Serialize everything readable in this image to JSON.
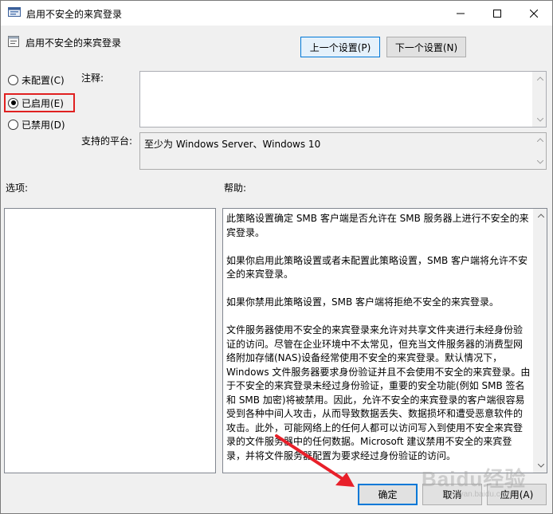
{
  "window": {
    "title": "启用不安全的来宾登录",
    "minimize_icon": "minimize-icon",
    "maximize_icon": "maximize-icon",
    "close_icon": "close-icon"
  },
  "header": {
    "policy_name": "启用不安全的来宾登录",
    "prev_label": "上一个设置(P)",
    "next_label": "下一个设置(N)"
  },
  "state": {
    "options": [
      {
        "label": "未配置(C)",
        "checked": false
      },
      {
        "label": "已启用(E)",
        "checked": true
      },
      {
        "label": "已禁用(D)",
        "checked": false
      }
    ]
  },
  "comment": {
    "label": "注释:",
    "value": ""
  },
  "platform": {
    "label": "支持的平台:",
    "value": "至少为 Windows Server、Windows 10"
  },
  "options_section": {
    "label": "选项:"
  },
  "help_section": {
    "label": "帮助:",
    "paragraphs": [
      "此策略设置确定 SMB 客户端是否允许在 SMB 服务器上进行不安全的来宾登录。",
      "如果你启用此策略设置或者未配置此策略设置，SMB 客户端将允许不安全的来宾登录。",
      "如果你禁用此策略设置，SMB 客户端将拒绝不安全的来宾登录。",
      "文件服务器使用不安全的来宾登录来允许对共享文件夹进行未经身份验证的访问。尽管在企业环境中不太常见，但充当文件服务器的消费型网络附加存储(NAS)设备经常使用不安全的来宾登录。默认情况下，Windows 文件服务器要求身份验证并且不会使用不安全的来宾登录。由于不安全的来宾登录未经过身份验证，重要的安全功能(例如 SMB 签名和 SMB 加密)将被禁用。因此，允许不安全的来宾登录的客户端很容易受到各种中间人攻击，从而导致数据丢失、数据损坏和遭受恶意软件的攻击。此外，可能网络上的任何人都可以访问写入到使用不安全来宾登录的文件服务器中的任何数据。Microsoft 建议禁用不安全的来宾登录，并将文件服务器配置为要求经过身份验证的访问。"
    ]
  },
  "footer": {
    "ok_label": "确定",
    "cancel_label": "取消",
    "apply_label": "应用(A)"
  },
  "watermark": {
    "text": "Baidu经验",
    "sub": "jingyan.baidu.com"
  },
  "colors": {
    "highlight": "#e02020",
    "arrow": "#e8202a",
    "accent": "#0078d7"
  }
}
